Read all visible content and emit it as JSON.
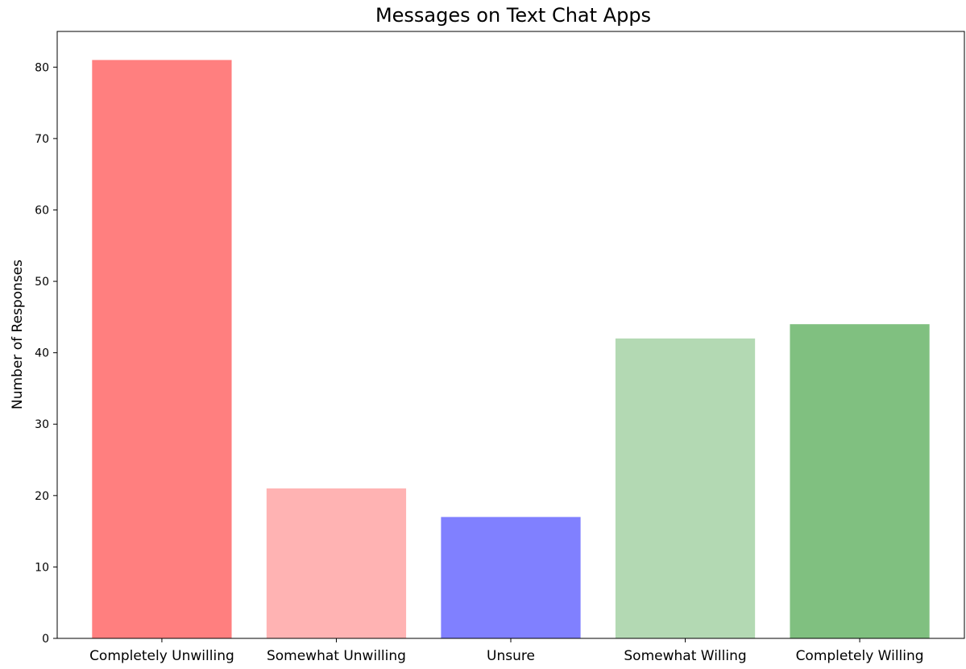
{
  "chart_data": {
    "type": "bar",
    "title": "Messages on Text Chat Apps",
    "xlabel": "",
    "ylabel": "Number of Responses",
    "categories": [
      "Completely Unwilling",
      "Somewhat Unwilling",
      "Unsure",
      "Somewhat Willing",
      "Completely Willing"
    ],
    "values": [
      81,
      21,
      17,
      42,
      44
    ],
    "colors": [
      "#ff7f7f",
      "#ffb3b3",
      "#8080ff",
      "#b3d9b3",
      "#80c080"
    ],
    "ylim": [
      0,
      85
    ],
    "yticks": [
      0,
      10,
      20,
      30,
      40,
      50,
      60,
      70,
      80
    ],
    "grid": false,
    "legend": "none"
  }
}
